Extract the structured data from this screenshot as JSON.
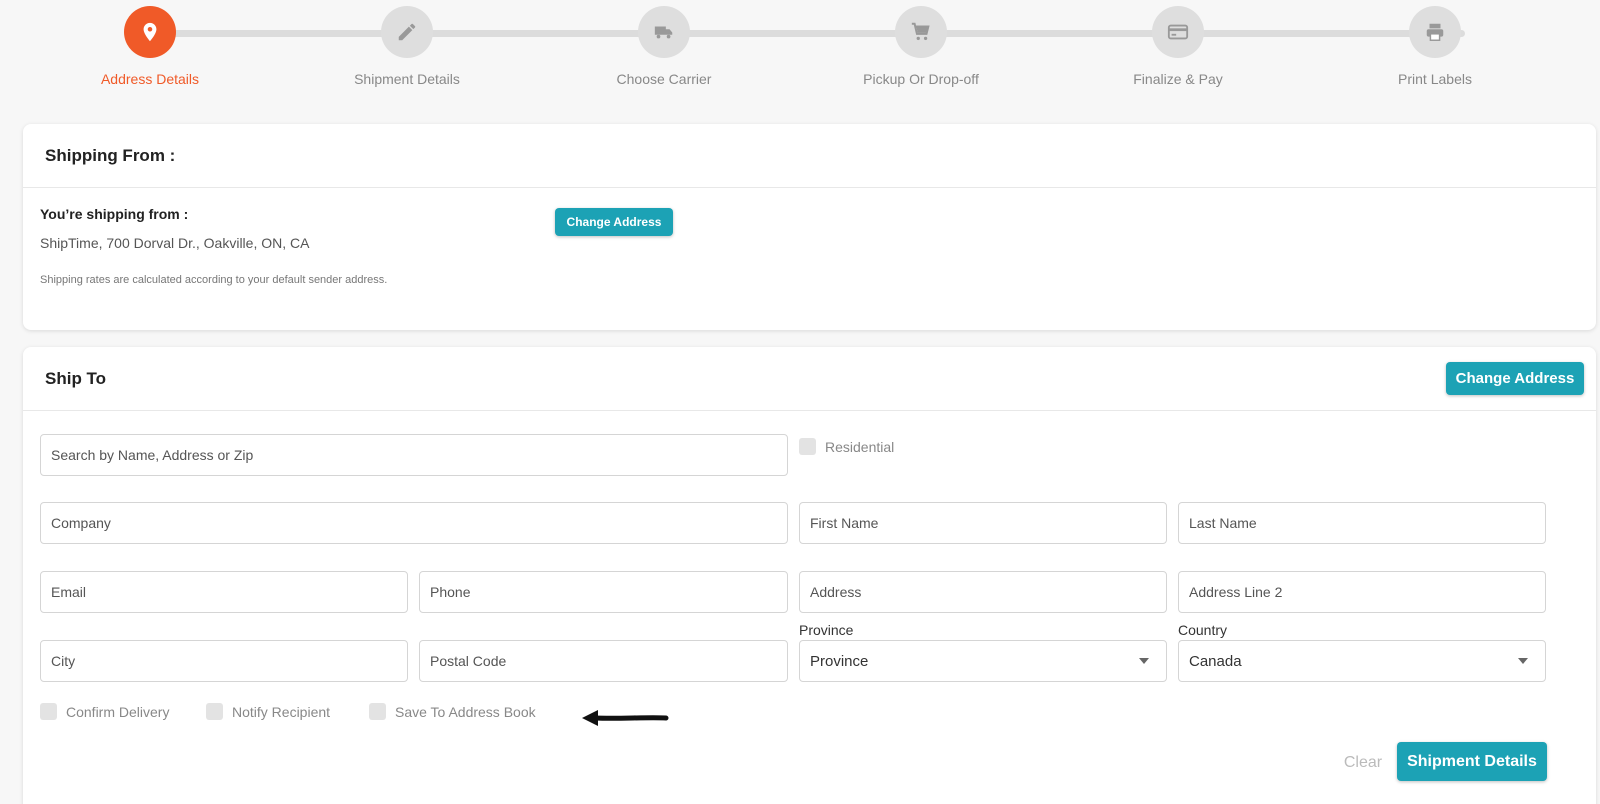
{
  "stepper": {
    "steps": [
      {
        "label": "Address Details",
        "icon": "map-pin-icon",
        "active": true
      },
      {
        "label": "Shipment Details",
        "icon": "pencil-icon",
        "active": false
      },
      {
        "label": "Choose Carrier",
        "icon": "truck-icon",
        "active": false
      },
      {
        "label": "Pickup Or Drop-off",
        "icon": "cart-icon",
        "active": false
      },
      {
        "label": "Finalize & Pay",
        "icon": "credit-card-icon",
        "active": false
      },
      {
        "label": "Print Labels",
        "icon": "printer-icon",
        "active": false
      }
    ],
    "active_color": "#f05a28",
    "inactive_color": "#dedede"
  },
  "shipping_from": {
    "title": "Shipping From :",
    "label": "You’re shipping from :",
    "address": "ShipTime, 700 Dorval Dr., Oakville, ON, CA",
    "note": "Shipping rates are calculated according to your default sender address.",
    "change_button": "Change Address"
  },
  "ship_to": {
    "title": "Ship To",
    "change_button": "Change Address",
    "search_placeholder": "Search by Name, Address or Zip",
    "residential_label": "Residential",
    "company_placeholder": "Company",
    "first_name_placeholder": "First Name",
    "last_name_placeholder": "Last Name",
    "email_placeholder": "Email",
    "phone_placeholder": "Phone",
    "address_placeholder": "Address",
    "address2_placeholder": "Address Line 2",
    "city_placeholder": "City",
    "postal_placeholder": "Postal Code",
    "province_label": "Province",
    "province_value": "Province",
    "country_label": "Country",
    "country_value": "Canada",
    "confirm_delivery_label": "Confirm Delivery",
    "notify_recipient_label": "Notify Recipient",
    "save_address_label": "Save To Address Book",
    "clear_label": "Clear",
    "next_button": "Shipment Details"
  },
  "colors": {
    "accent": "#1ca2b5",
    "brand": "#f05a28"
  }
}
